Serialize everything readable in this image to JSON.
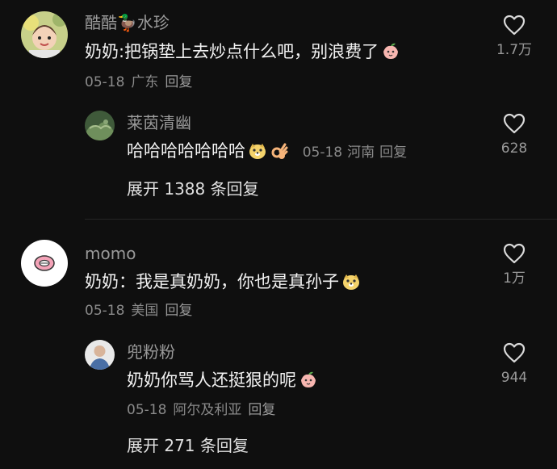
{
  "comments": [
    {
      "username": "酷酷🦆水珍",
      "text": "奶奶:把锅垫上去炒点什么吧，别浪费了",
      "date": "05-18",
      "location": "广东",
      "reply_label": "回复",
      "likes": "1.7万",
      "emoji": "peach-face-emoji",
      "replies": [
        {
          "username": "莱茵清幽",
          "text": "哈哈哈哈哈哈哈",
          "date": "05-18",
          "location": "河南",
          "reply_label": "回复",
          "likes": "628"
        }
      ],
      "expand_label": "展开 1388 条回复"
    },
    {
      "username": "momo",
      "text": "奶奶：我是真奶奶，你也是真孙子",
      "date": "05-18",
      "location": "美国",
      "reply_label": "回复",
      "likes": "1万",
      "emoji": "doge-face-emoji",
      "replies": [
        {
          "username": "兜粉粉",
          "text": "奶奶你骂人还挺狠的呢",
          "date": "05-18",
          "location": "阿尔及利亚",
          "reply_label": "回复",
          "likes": "944"
        }
      ],
      "expand_label": "展开 271 条回复"
    }
  ],
  "colors": {
    "background": "#0f0f0f",
    "text_primary": "#f2f2f2",
    "text_secondary": "#9a9a9a"
  },
  "icons": {
    "like": "heart-outline-icon"
  }
}
